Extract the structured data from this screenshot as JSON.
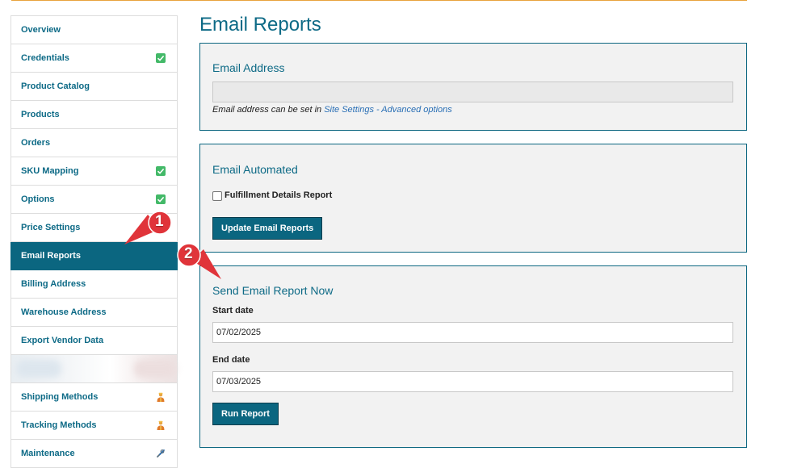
{
  "sidebar": {
    "items": [
      {
        "label": "Overview",
        "icon": ""
      },
      {
        "label": "Credentials",
        "icon": "check-icon"
      },
      {
        "label": "Product Catalog",
        "icon": ""
      },
      {
        "label": "Products",
        "icon": ""
      },
      {
        "label": "Orders",
        "icon": ""
      },
      {
        "label": "SKU Mapping",
        "icon": "check-icon"
      },
      {
        "label": "Options",
        "icon": "check-icon"
      },
      {
        "label": "Price Settings",
        "icon": ""
      },
      {
        "label": "Email Reports",
        "icon": "",
        "active": true
      },
      {
        "label": "Billing Address",
        "icon": ""
      },
      {
        "label": "Warehouse Address",
        "icon": ""
      },
      {
        "label": "Export Vendor Data",
        "icon": ""
      },
      {
        "label": "",
        "icon": "",
        "blurred": true
      },
      {
        "label": "Shipping Methods",
        "icon": "worker-icon"
      },
      {
        "label": "Tracking Methods",
        "icon": "worker-icon"
      },
      {
        "label": "Maintenance",
        "icon": "tools-icon"
      }
    ]
  },
  "main": {
    "title": "Email Reports",
    "email_address": {
      "title": "Email Address",
      "value": "",
      "hint_prefix": "Email address can be set in ",
      "hint_link": "Site Settings - Advanced options"
    },
    "email_automated": {
      "title": "Email Automated",
      "checkbox_label": "Fulfillment Details Report",
      "checked": false,
      "button_label": "Update Email Reports"
    },
    "send_now": {
      "title": "Send Email Report Now",
      "start_label": "Start date",
      "start_value": "07/02/2025",
      "end_label": "End date",
      "end_value": "07/03/2025",
      "button_label": "Run Report"
    }
  },
  "annotations": [
    {
      "number": "1"
    },
    {
      "number": "2"
    }
  ],
  "colors": {
    "accent": "#0b6680",
    "link": "#2a6fb5",
    "check": "#43b968",
    "marker": "#e0343a",
    "top_border": "#e8a33d"
  }
}
